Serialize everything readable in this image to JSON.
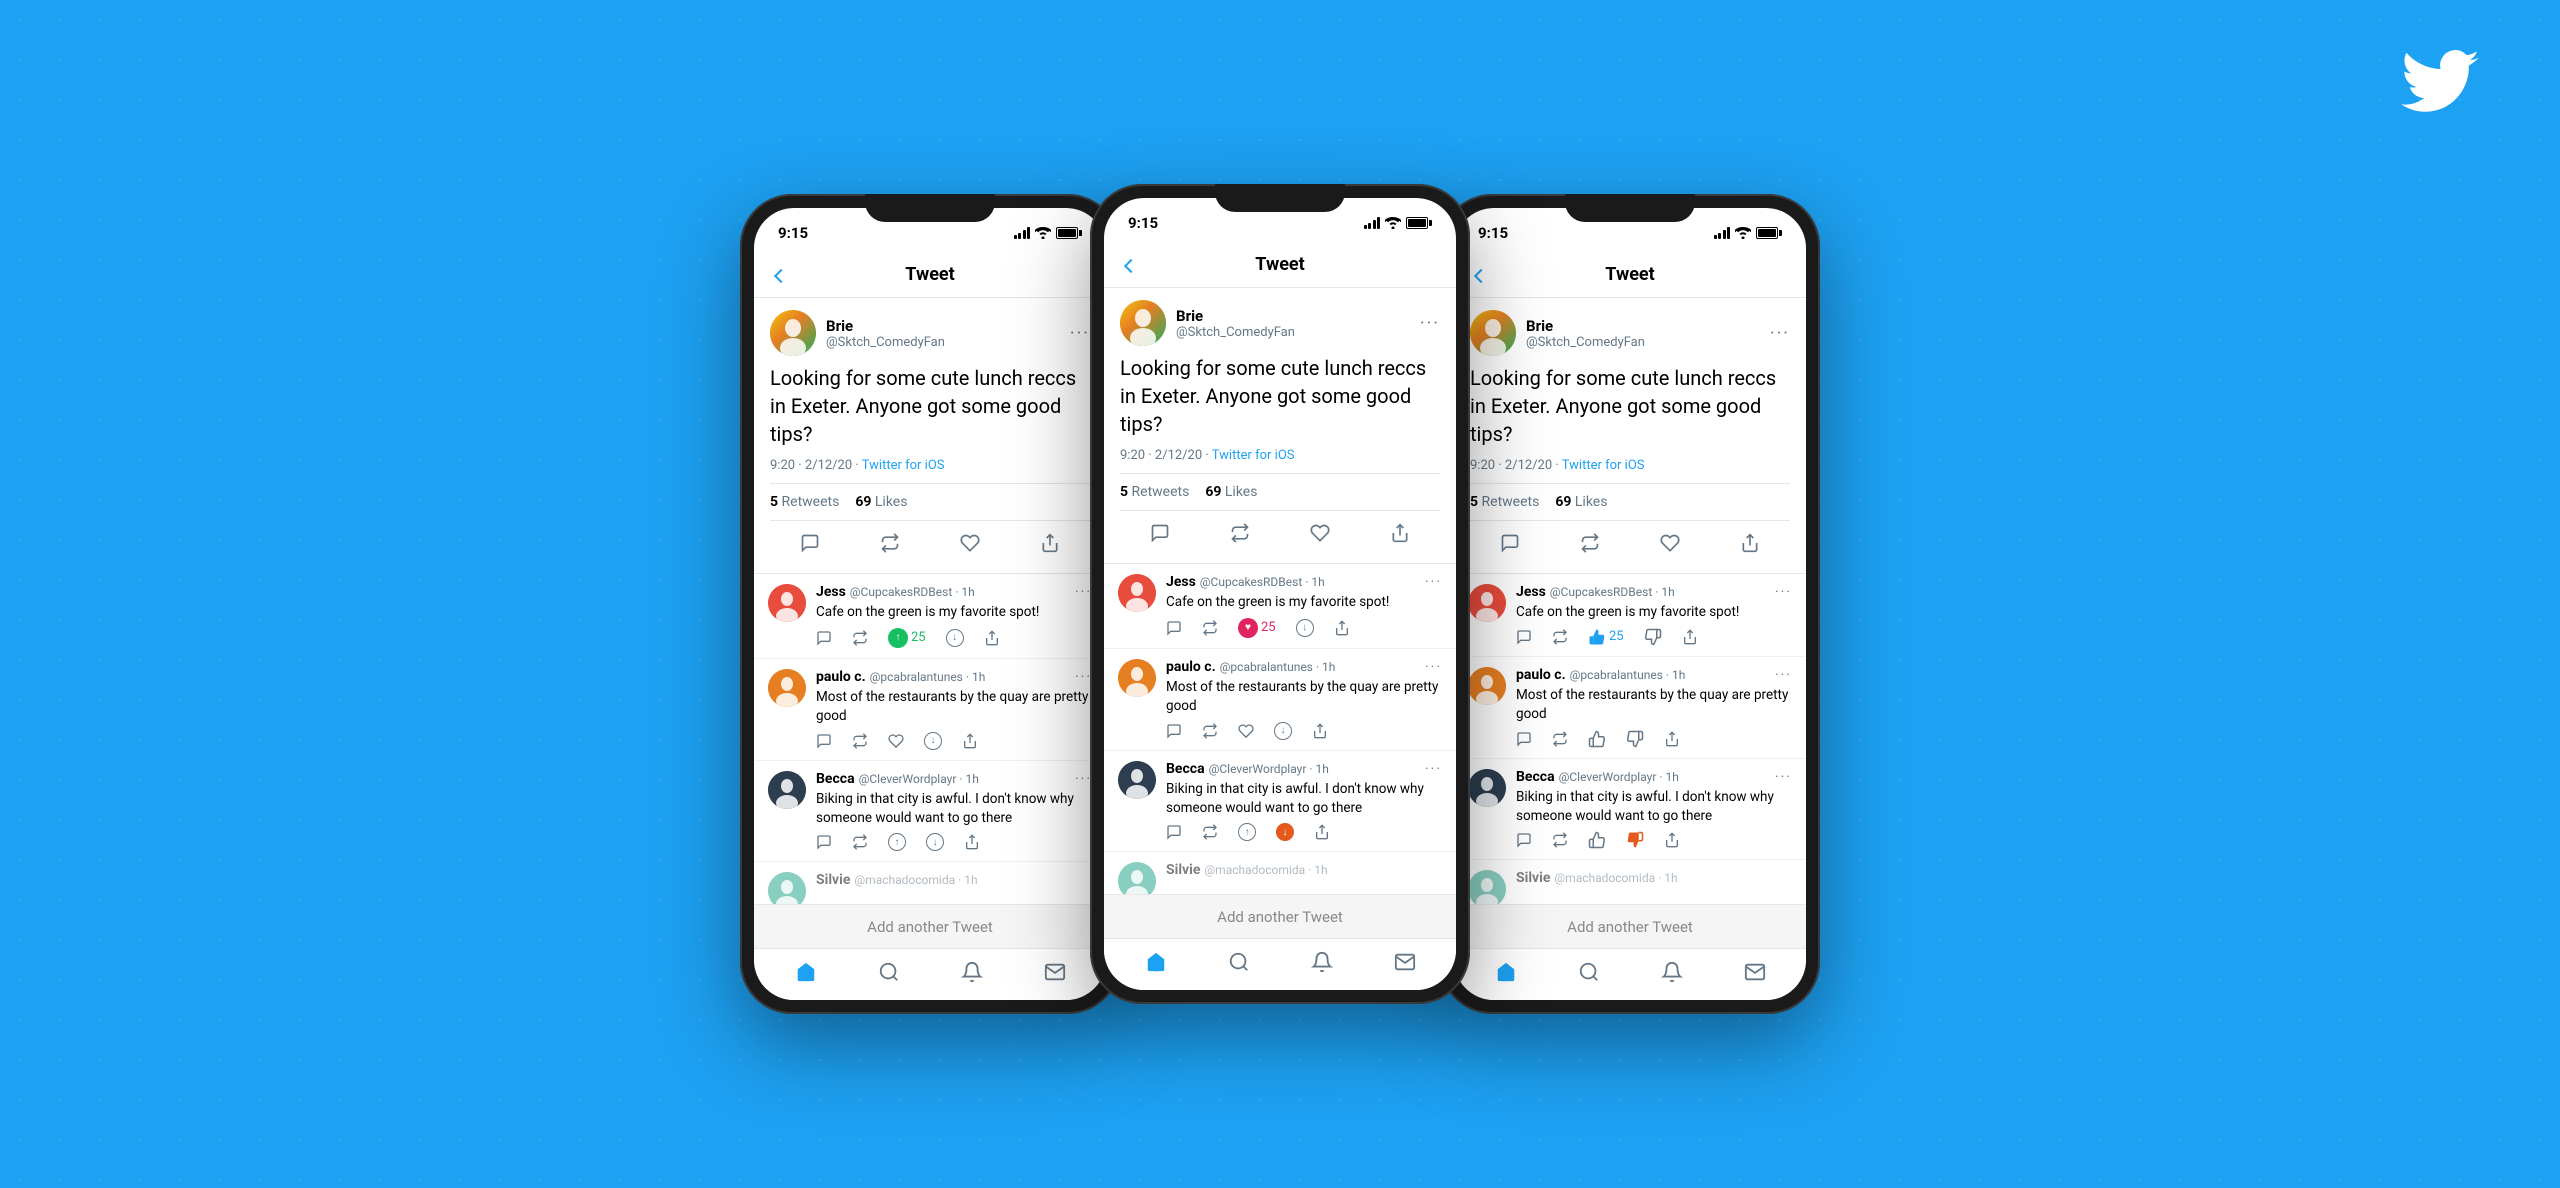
{
  "background_color": "#1DA1F2",
  "twitter_logo": "Twitter Bird",
  "phones": [
    {
      "id": "phone-1",
      "status_time": "9:15",
      "nav_title": "Tweet",
      "main_tweet": {
        "user_name": "Brie",
        "user_handle": "@Sktch_ComedyFan",
        "text": "Looking for some cute lunch reccs in Exeter. Anyone got some good tips?",
        "time": "9:20 · 2/12/20",
        "source": "Twitter for iOS",
        "retweets": "5 Retweets",
        "likes": "69 Likes"
      },
      "replies": [
        {
          "name": "Jess",
          "handle": "@CupcakesRDBest",
          "time": "1h",
          "text": "Cafe on the green is my favorite spot!",
          "reaction_type": "green_retweet",
          "count": "25",
          "avatar_color": "jess"
        },
        {
          "name": "paulo c.",
          "handle": "@pcabralantunes",
          "time": "1h",
          "text": "Most of the restaurants by the quay are pretty good",
          "reaction_type": "none",
          "count": "",
          "avatar_color": "paulo"
        },
        {
          "name": "Becca",
          "handle": "@CleverWordplayr",
          "time": "1h",
          "text": "Biking in that city is awful. I don't know why someone would want to go there",
          "reaction_type": "arrow_up",
          "count": "",
          "avatar_color": "becca"
        },
        {
          "name": "Silvie",
          "handle": "@machadocomida",
          "time": "1h",
          "text": "",
          "reaction_type": "none",
          "count": "",
          "avatar_color": "silvie"
        }
      ],
      "add_tweet_label": "Add another Tweet"
    },
    {
      "id": "phone-2",
      "status_time": "9:15",
      "nav_title": "Tweet",
      "main_tweet": {
        "user_name": "Brie",
        "user_handle": "@Sktch_ComedyFan",
        "text": "Looking for some cute lunch reccs in Exeter. Anyone got some good tips?",
        "time": "9:20 · 2/12/20",
        "source": "Twitter for iOS",
        "retweets": "5 Retweets",
        "likes": "69 Likes"
      },
      "replies": [
        {
          "name": "Jess",
          "handle": "@CupcakesRDBest",
          "time": "1h",
          "text": "Cafe on the green is my favorite spot!",
          "reaction_type": "pink_heart",
          "count": "25",
          "avatar_color": "jess"
        },
        {
          "name": "paulo c.",
          "handle": "@pcabralantunes",
          "time": "1h",
          "text": "Most of the restaurants by the quay are pretty good",
          "reaction_type": "none",
          "count": "",
          "avatar_color": "paulo"
        },
        {
          "name": "Becca",
          "handle": "@CleverWordplayr",
          "time": "1h",
          "text": "Biking in that city is awful. I don't know why someone would want to go there",
          "reaction_type": "arrow_down_orange",
          "count": "",
          "avatar_color": "becca"
        },
        {
          "name": "Silvie",
          "handle": "@machadocomida",
          "time": "1h",
          "text": "",
          "reaction_type": "none",
          "count": "",
          "avatar_color": "silvie"
        }
      ],
      "add_tweet_label": "Add another Tweet"
    },
    {
      "id": "phone-3",
      "status_time": "9:15",
      "nav_title": "Tweet",
      "main_tweet": {
        "user_name": "Brie",
        "user_handle": "@Sktch_ComedyFan",
        "text": "Looking for some cute lunch reccs in Exeter. Anyone got some good tips?",
        "time": "9:20 · 2/12/20",
        "source": "Twitter for iOS",
        "retweets": "5 Retweets",
        "likes": "69 Likes"
      },
      "replies": [
        {
          "name": "Jess",
          "handle": "@CupcakesRDBest",
          "time": "1h",
          "text": "Cafe on the green is my favorite spot!",
          "reaction_type": "blue_thumb_up",
          "count": "25",
          "avatar_color": "jess"
        },
        {
          "name": "paulo c.",
          "handle": "@pcabralantunes",
          "time": "1h",
          "text": "Most of the restaurants by the quay are pretty good",
          "reaction_type": "none",
          "count": "",
          "avatar_color": "paulo"
        },
        {
          "name": "Becca",
          "handle": "@CleverWordplayr",
          "time": "1h",
          "text": "Biking in that city is awful. I don't know why someone would want to go there",
          "reaction_type": "orange_thumb_down",
          "count": "",
          "avatar_color": "becca"
        },
        {
          "name": "Silvie",
          "handle": "@machadocomida",
          "time": "1h",
          "text": "",
          "reaction_type": "none",
          "count": "",
          "avatar_color": "silvie"
        }
      ],
      "add_tweet_label": "Add another Tweet"
    }
  ]
}
